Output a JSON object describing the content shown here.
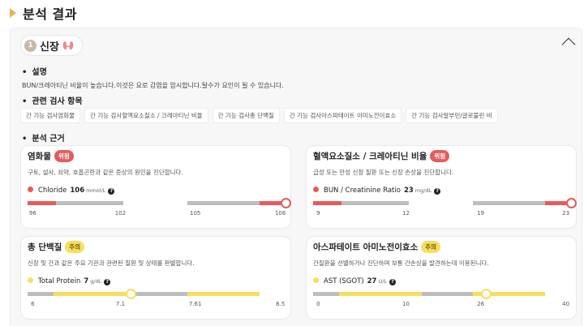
{
  "header": {
    "title": "분석 결과"
  },
  "section": {
    "number": "1",
    "label": "신장"
  },
  "headings": {
    "description": "설명",
    "related": "관련 검사 항목",
    "basis": "분석 근거"
  },
  "description_text": "BUN/크레아티닌 비율이 높습니다.이것은 요로 감염을 암시합니다.탈수가 요인이 될 수 있습니다.",
  "related_items": [
    "간 기능 검사염화물",
    "간 기능 검사혈액요소질소 / 크레아티닌 비율",
    "간 기능 검사총 단백질",
    "간 기능 검사아스파테이트 아미노전이효소",
    "간 기능 검사알부민/글로불린 비"
  ],
  "colors": {
    "danger": "#e75b5b",
    "caution": "#f7de5e",
    "normal": "#bdbdbd"
  },
  "cards": [
    {
      "name": "염화물",
      "badge": "위험",
      "level": "red",
      "desc": "구토, 설사, 쇠약, 호흡곤란과 같은 증상의 원인을 진단합니다.",
      "test": "Chloride",
      "value": "106",
      "unit": "mmol/L",
      "ticks": [
        "96",
        "102",
        "105",
        "106"
      ],
      "marker_fraction": 1.0,
      "segment_colors": [
        "red",
        "gray",
        "gray",
        "red"
      ]
    },
    {
      "name": "혈액요소질소 / 크레아티닌 비율",
      "badge": "위험",
      "level": "red",
      "desc": "급성 또는 만성 신장 질환 또는 신장 손상을 진단합니다.",
      "test": "BUN / Creatinine Ratio",
      "value": "23",
      "unit": "mg/dL",
      "ticks": [
        "9",
        "12",
        "19",
        "23"
      ],
      "marker_fraction": 1.0,
      "segment_colors": [
        "red",
        "gray",
        "gray",
        "red"
      ]
    },
    {
      "name": "총 단백질",
      "badge": "주의",
      "level": "yellow",
      "desc": "신장 및 간과 같은 주요 기관과 관련된 질환 및 상태를 판별합니다.",
      "test": "Total Protein",
      "value": "7",
      "unit": "g/dL",
      "ticks": [
        "6",
        "7.1",
        "7.61",
        "8.5"
      ],
      "marker_fraction": 0.4,
      "segment_colors": [
        "gray",
        "yellow",
        "gray",
        "yellow"
      ]
    },
    {
      "name": "아스파테이트 아미노전이효소",
      "badge": "주의",
      "level": "yellow",
      "desc": "간질환을 선별하거나 진단하며 보통 간손상을 발견하는데 이용된니다.",
      "test": "AST (SGOT)",
      "value": "27",
      "unit": "U/L",
      "ticks": [
        "0",
        "10",
        "26",
        "40"
      ],
      "marker_fraction": 0.67,
      "segment_colors": [
        "gray",
        "yellow",
        "gray",
        "yellow"
      ]
    }
  ]
}
